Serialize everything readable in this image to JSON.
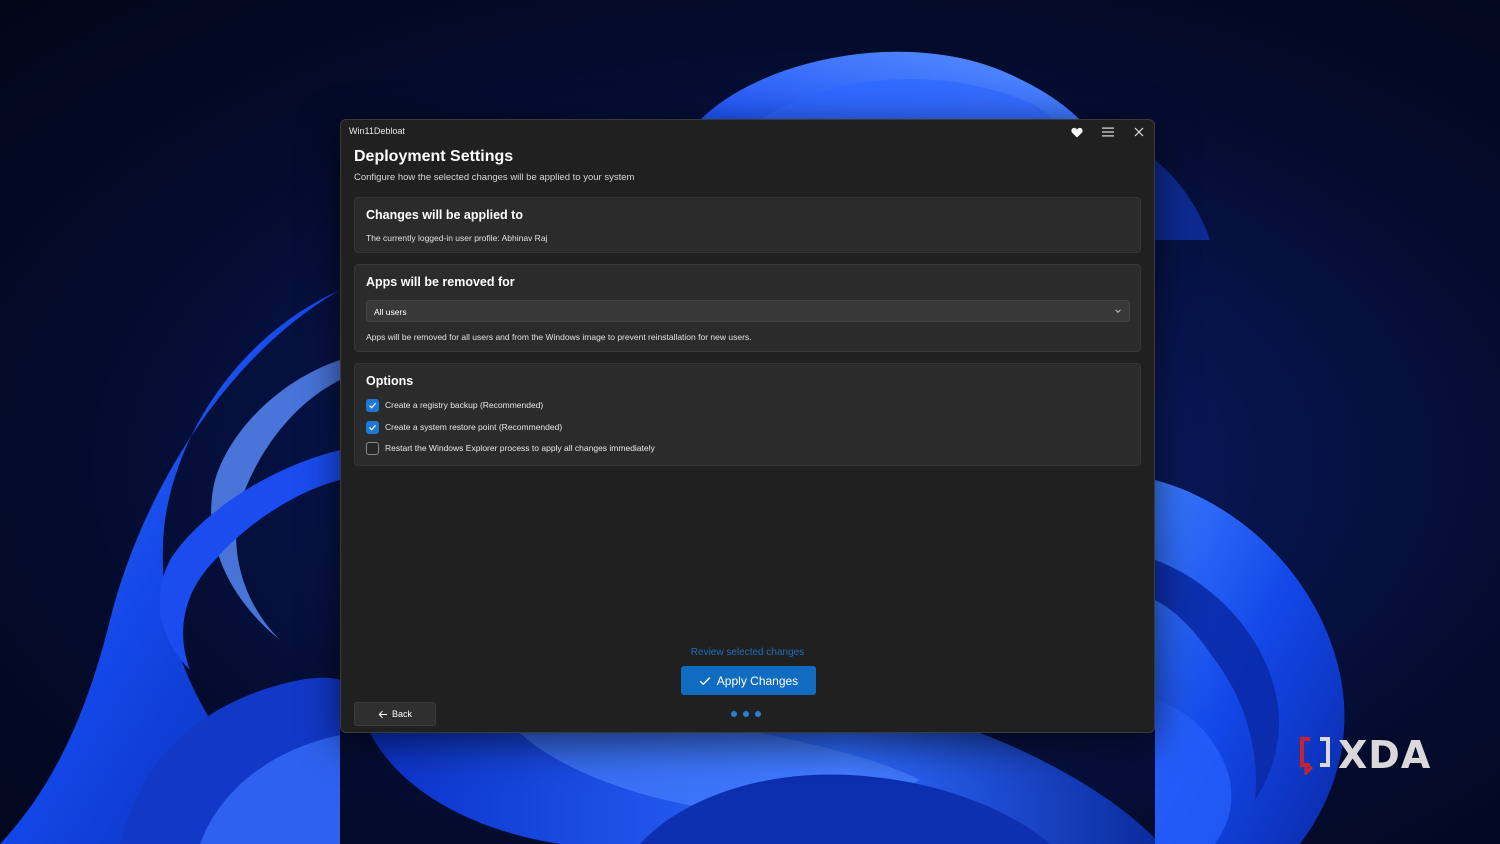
{
  "window": {
    "app_title": "Win11Debloat",
    "icons": [
      "heart-icon",
      "hamburger-menu-icon",
      "close-icon"
    ]
  },
  "page": {
    "title": "Deployment Settings",
    "subtitle": "Configure how the selected changes will be applied to your system"
  },
  "applied_to": {
    "title": "Changes will be applied to",
    "text": "The currently logged-in user profile: Abhinav Raj"
  },
  "removed_for": {
    "title": "Apps will be removed for",
    "selected": "All users",
    "description": "Apps will be removed for all users and from the Windows image to prevent reinstallation for new users."
  },
  "options": {
    "title": "Options",
    "items": [
      {
        "label": "Create a registry backup (Recommended)",
        "checked": true
      },
      {
        "label": "Create a system restore point (Recommended)",
        "checked": true
      },
      {
        "label": "Restart the Windows Explorer process to apply all changes immediately",
        "checked": false
      }
    ]
  },
  "footer": {
    "review_link": "Review selected changes",
    "apply_label": "Apply Changes",
    "back_label": "Back",
    "step_count": 3
  },
  "watermark": {
    "text": "XDA"
  },
  "colors": {
    "accent": "#0f6cc0",
    "window_bg": "#202020",
    "card_bg": "#2b2b2b",
    "checkbox_checked": "#1a78d6",
    "link": "#1e6cb8"
  }
}
